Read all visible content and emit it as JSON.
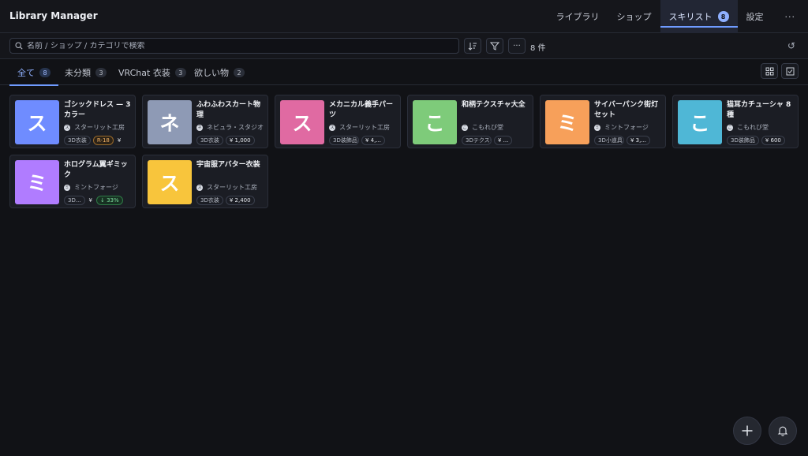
{
  "app": {
    "title": "Library Manager"
  },
  "nav": {
    "library": "ライブラリ",
    "shop": "ショップ",
    "skillist": "スキリスト",
    "skillist_badge": "8",
    "settings": "設定",
    "more": "···"
  },
  "search": {
    "placeholder": "名前 / ショップ / カテゴリで検索",
    "value": "",
    "count_label": "8 件"
  },
  "tabs": [
    {
      "label": "全て",
      "count": "8"
    },
    {
      "label": "未分類",
      "count": "3"
    },
    {
      "label": "VRChat 衣装",
      "count": "3"
    },
    {
      "label": "欲しい物",
      "count": "2"
    }
  ],
  "items": [
    {
      "initial": "ス",
      "color": "#6f8cff",
      "title": "ゴシックドレス — 3カラー",
      "shop_icon": "ス",
      "shop": "スターリット工房",
      "category": "3D衣装",
      "tags": [
        "R-18"
      ],
      "price": "¥"
    },
    {
      "initial": "ネ",
      "color": "#8e9ab5",
      "title": "ふわふわスカート物理",
      "shop_icon": "ネ",
      "shop": "ネビュラ・スタジオ",
      "category": "3D衣装",
      "tags": [],
      "price": "¥ 1,000"
    },
    {
      "initial": "ス",
      "color": "#e06aa2",
      "title": "メカニカル義手パーツ",
      "shop_icon": "ス",
      "shop": "スターリット工房",
      "category": "3D装飾品",
      "tags": [],
      "price": "¥ 4,..."
    },
    {
      "initial": "こ",
      "color": "#7ecb7a",
      "title": "和柄テクスチャ大全",
      "shop_icon": "こ",
      "shop": "こもれび堂",
      "category": "3Dテクスチャ",
      "tags": [],
      "price": "¥ ..."
    },
    {
      "initial": "ミ",
      "color": "#f7a05a",
      "title": "サイバーパンク街灯セット",
      "shop_icon": "ミ",
      "shop": "ミントフォージ",
      "category": "3D小道具",
      "tags": [],
      "price": "¥ 3,..."
    },
    {
      "initial": "こ",
      "color": "#4fb7d6",
      "title": "猫耳カチューシャ 8種",
      "shop_icon": "こ",
      "shop": "こもれび堂",
      "category": "3D装飾品",
      "tags": [],
      "price": "¥ 600"
    },
    {
      "initial": "ミ",
      "color": "#b07cff",
      "title": "ホログラム翼ギミック",
      "shop_icon": "ミ",
      "shop": "ミントフォージ",
      "category": "3D...",
      "tags": [],
      "price": "¥",
      "sale": "↓ 33%"
    },
    {
      "initial": "ス",
      "color": "#f8c53c",
      "title": "宇宙服アバター衣装",
      "shop_icon": "ス",
      "shop": "スターリット工房",
      "category": "3D衣装",
      "tags": [],
      "price": "¥ 2,400"
    }
  ]
}
